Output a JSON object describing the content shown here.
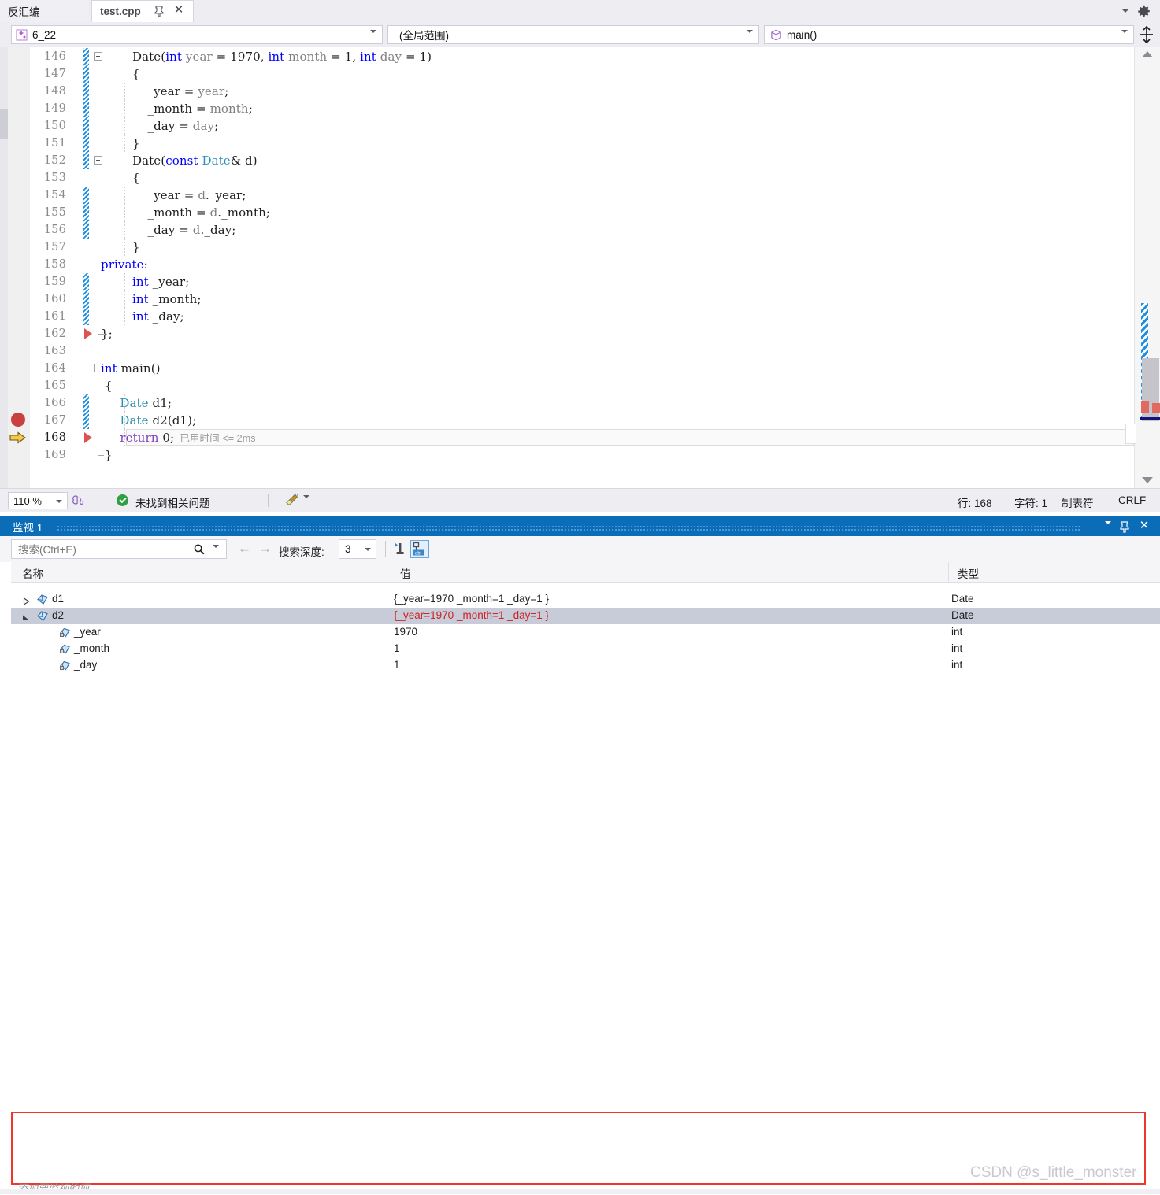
{
  "tabs": {
    "disassembly_label": "反汇编",
    "active_label": "test.cpp",
    "pin_glyph": "⇱",
    "close_glyph": "✕"
  },
  "navbar": {
    "project": "6_22",
    "scope": "(全局范围)",
    "member": "main()"
  },
  "editor": {
    "lines": [
      {
        "num": "146",
        "indent": 40,
        "html": "Date(<span class=\"kw\">int</span> <span class=\"param\">year</span> = 1970, <span class=\"kw\">int</span> <span class=\"param\">month</span> = 1, <span class=\"kw\">int</span> <span class=\"param\">day</span> = 1)"
      },
      {
        "num": "147",
        "indent": 40,
        "html": "{"
      },
      {
        "num": "148",
        "indent": 40,
        "html": "    _year = <span class=\"param\">year</span>;"
      },
      {
        "num": "149",
        "indent": 40,
        "html": "    _month = <span class=\"param\">month</span>;"
      },
      {
        "num": "150",
        "indent": 40,
        "html": "    _day = <span class=\"param\">day</span>;"
      },
      {
        "num": "151",
        "indent": 40,
        "html": "}"
      },
      {
        "num": "152",
        "indent": 40,
        "html": "Date(<span class=\"kw\">const</span> <span class=\"typ\">Date</span>&amp; d)"
      },
      {
        "num": "153",
        "indent": 40,
        "html": "{"
      },
      {
        "num": "154",
        "indent": 40,
        "html": "    _year = <span class=\"param\">d</span>._year;"
      },
      {
        "num": "155",
        "indent": 40,
        "html": "    _month = <span class=\"param\">d</span>._month;"
      },
      {
        "num": "156",
        "indent": 40,
        "html": "    _day = <span class=\"param\">d</span>._day;"
      },
      {
        "num": "157",
        "indent": 40,
        "html": "}"
      },
      {
        "num": "158",
        "indent": 0,
        "html": "<span class=\"kw\">private</span>:"
      },
      {
        "num": "159",
        "indent": 40,
        "html": "<span class=\"kw\">int</span> _year;"
      },
      {
        "num": "160",
        "indent": 40,
        "html": "<span class=\"kw\">int</span> _month;"
      },
      {
        "num": "161",
        "indent": 40,
        "html": "<span class=\"kw\">int</span> _day;"
      },
      {
        "num": "162",
        "indent": 0,
        "html": "};"
      },
      {
        "num": "163",
        "indent": 0,
        "html": ""
      },
      {
        "num": "164",
        "indent": 0,
        "html": "<span class=\"kw\">int</span> main()"
      },
      {
        "num": "165",
        "indent": 0,
        "html": " {"
      },
      {
        "num": "166",
        "indent": 0,
        "html": "     <span class=\"typ\">Date</span> d1;"
      },
      {
        "num": "167",
        "indent": 0,
        "html": "     <span class=\"typ\">Date</span> d2(d1);"
      },
      {
        "num": "168",
        "indent": 0,
        "html": "     <span class=\"kw2\">return</span> 0;"
      },
      {
        "num": "169",
        "indent": 0,
        "html": " }"
      }
    ],
    "elapsed_annotation": "已用时间 <= 2ms",
    "current_line": "168"
  },
  "status": {
    "zoom": "110 %",
    "problems": "未找到相关问题",
    "line_label": "行: 168",
    "char_label": "字符: 1",
    "tab_label": "制表符",
    "eol_label": "CRLF"
  },
  "watch": {
    "title": "监视 1",
    "search_placeholder": "搜索(Ctrl+E)",
    "depth_label": "搜索深度:",
    "depth_value": "3",
    "columns": [
      "名称",
      "值",
      "类型"
    ],
    "rows": [
      {
        "name": "d1",
        "value": "{_year=1970 _month=1 _day=1 }",
        "type": "Date",
        "expander": "collapsed",
        "icon": "object-icon",
        "indent": 0,
        "selected": false,
        "value_red": false
      },
      {
        "name": "d2",
        "value": "{_year=1970 _month=1 _day=1 }",
        "type": "Date",
        "expander": "expanded",
        "icon": "object-icon",
        "indent": 0,
        "selected": true,
        "value_red": true
      },
      {
        "name": "_year",
        "value": "1970",
        "type": "int",
        "expander": "none",
        "icon": "lock-icon",
        "indent": 1,
        "selected": false,
        "value_red": false
      },
      {
        "name": "_month",
        "value": "1",
        "type": "int",
        "expander": "none",
        "icon": "lock-icon",
        "indent": 1,
        "selected": false,
        "value_red": false
      },
      {
        "name": "_day",
        "value": "1",
        "type": "int",
        "expander": "none",
        "icon": "lock-icon",
        "indent": 1,
        "selected": false,
        "value_red": false
      }
    ],
    "add_item_placeholder": "添加要监视的项",
    "pin_glyph": "⇱",
    "close_glyph": "✕"
  },
  "watermark": "CSDN @s_little_monster",
  "colors": {
    "accent_blue": "#0b6cb7",
    "keyword": "#0000ff",
    "type": "#2b91af",
    "control": "#7f3fbf",
    "error_red": "#cf2222",
    "outline_red": "#f0352b",
    "breakpoint": "#c9413f",
    "changebar": "#1c8fe0",
    "selection": "#c8cbd8"
  }
}
